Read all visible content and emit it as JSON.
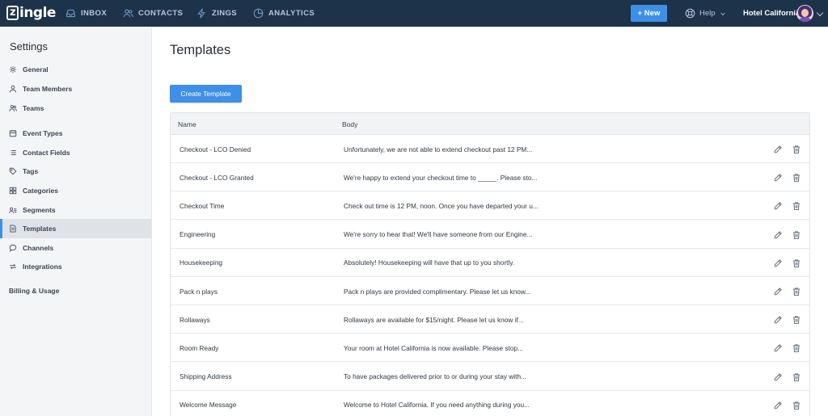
{
  "app": {
    "logo_text": "zingle"
  },
  "nav": [
    {
      "label": "INBOX",
      "icon": "inbox-icon"
    },
    {
      "label": "CONTACTS",
      "icon": "contacts-icon"
    },
    {
      "label": "ZINGS",
      "icon": "bolt-icon"
    },
    {
      "label": "ANALYTICS",
      "icon": "pie-chart-icon"
    }
  ],
  "header": {
    "new_label": "+ New",
    "help_label": "Help",
    "account_name": "Hotel California"
  },
  "sidebar": {
    "title": "Settings",
    "items": [
      {
        "label": "General",
        "icon": "gear-icon"
      },
      {
        "label": "Team Members",
        "icon": "user-icon"
      },
      {
        "label": "Teams",
        "icon": "users-icon"
      },
      {
        "label": "Event Types",
        "icon": "calendar-icon"
      },
      {
        "label": "Contact Fields",
        "icon": "list-icon"
      },
      {
        "label": "Tags",
        "icon": "tag-icon"
      },
      {
        "label": "Categories",
        "icon": "grid-icon"
      },
      {
        "label": "Segments",
        "icon": "segments-icon"
      },
      {
        "label": "Templates",
        "icon": "document-icon",
        "active": true
      },
      {
        "label": "Channels",
        "icon": "chat-bubble-icon"
      },
      {
        "label": "Integrations",
        "icon": "sync-icon"
      }
    ],
    "billing_label": "Billing & Usage"
  },
  "main": {
    "title": "Templates",
    "create_label": "Create Template",
    "columns": [
      "Name",
      "Body"
    ],
    "rows": [
      {
        "name": "Checkout - LCO Denied",
        "body": "Unfortunately, we are not able to extend checkout past 12 PM..."
      },
      {
        "name": "Checkout - LCO Granted",
        "body": "We're happy to extend your checkout time to _____. Please sto..."
      },
      {
        "name": "Checkout Time",
        "body": "Check out time is 12 PM, noon. Once you have departed your u..."
      },
      {
        "name": "Engineering",
        "body": "We're sorry to hear that! We'll have someone from our Engine..."
      },
      {
        "name": "Housekeeping",
        "body": "Absolutely! Housekeeping will have that up to you shortly."
      },
      {
        "name": "Pack n plays",
        "body": "Pack n plays are provided complimentary. Please let us know..."
      },
      {
        "name": "Rollaways",
        "body": "Rollaways are available for $15/night. Please let us know if..."
      },
      {
        "name": "Room Ready",
        "body": "Your room at Hotel California is now available. Please stop..."
      },
      {
        "name": "Shipping Address",
        "body": "To have packages delivered prior to or during your stay with..."
      },
      {
        "name": "Welcome Message",
        "body": "Welcome to Hotel California. If you need anything during you..."
      }
    ]
  },
  "colors": {
    "topbar": "#1c3349",
    "accent": "#3e8fe6",
    "sidebar_bg": "#f4f5f7"
  }
}
